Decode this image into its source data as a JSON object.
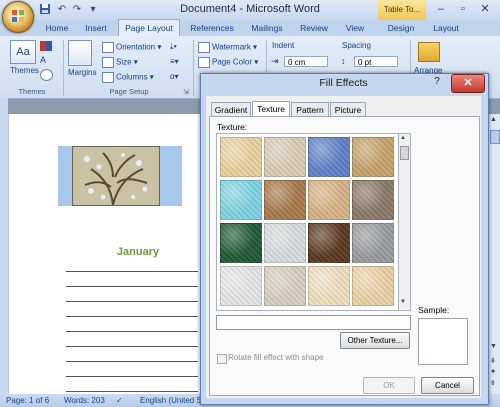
{
  "window": {
    "title": "Document4 - Microsoft Word",
    "contextual_tab": "Table To..."
  },
  "quick_access": {
    "save_icon": "save-icon",
    "undo_icon": "undo-icon",
    "redo_icon": "redo-icon"
  },
  "tabs": [
    "Home",
    "Insert",
    "Page Layout",
    "References",
    "Mailings",
    "Review",
    "View",
    "Design",
    "Layout"
  ],
  "active_tab": "Page Layout",
  "ribbon": {
    "themes": {
      "label": "Themes",
      "group": "Themes"
    },
    "margins": {
      "label": "Margins"
    },
    "orientation": "Orientation",
    "size": "Size",
    "columns": "Columns",
    "page_setup_group": "Page Setup",
    "watermark": "Watermark",
    "page_color": "Page Color",
    "indent_label": "Indent",
    "indent_left": "0 cm",
    "spacing_label": "Spacing",
    "spacing_before": "0 pt",
    "arrange": "Arrange"
  },
  "document": {
    "month_heading": "January",
    "line_count": 9
  },
  "status_bar": {
    "page": "Page: 1 of 6",
    "words": "Words: 203",
    "language": "English (United S"
  },
  "dialog": {
    "title": "Fill Effects",
    "help": "?",
    "close": "✕",
    "tabs": [
      "Gradient",
      "Texture",
      "Pattern",
      "Picture"
    ],
    "active_tab": "Texture",
    "texture_label": "Texture:",
    "texture_name": "",
    "other_texture": "Other Texture...",
    "rotate_label": "Rotate fill effect with shape",
    "rotate_checked": false,
    "sample_label": "Sample:",
    "ok": "OK",
    "cancel": "Cancel",
    "textures": [
      {
        "name": "papyrus",
        "color": "#e9d2a1"
      },
      {
        "name": "canvas",
        "color": "#d9cdb4"
      },
      {
        "name": "denim",
        "color": "#5f80c8"
      },
      {
        "name": "woven-mat",
        "color": "#c8a46c"
      },
      {
        "name": "water-droplets",
        "color": "#7fd4e2"
      },
      {
        "name": "paper-bag",
        "color": "#a7794a"
      },
      {
        "name": "fish-fossil",
        "color": "#d8b285"
      },
      {
        "name": "sand",
        "color": "#8c7a68"
      },
      {
        "name": "green-marble",
        "color": "#1f5a33"
      },
      {
        "name": "white-marble",
        "color": "#d9dcdc"
      },
      {
        "name": "brown-marble",
        "color": "#5b3820"
      },
      {
        "name": "granite",
        "color": "#9b9c9e"
      },
      {
        "name": "newsprint",
        "color": "#e6e6e6"
      },
      {
        "name": "recycled-paper",
        "color": "#d8cfc0"
      },
      {
        "name": "parchment",
        "color": "#f0e0c0"
      },
      {
        "name": "stationery",
        "color": "#ecd3a7"
      }
    ]
  }
}
